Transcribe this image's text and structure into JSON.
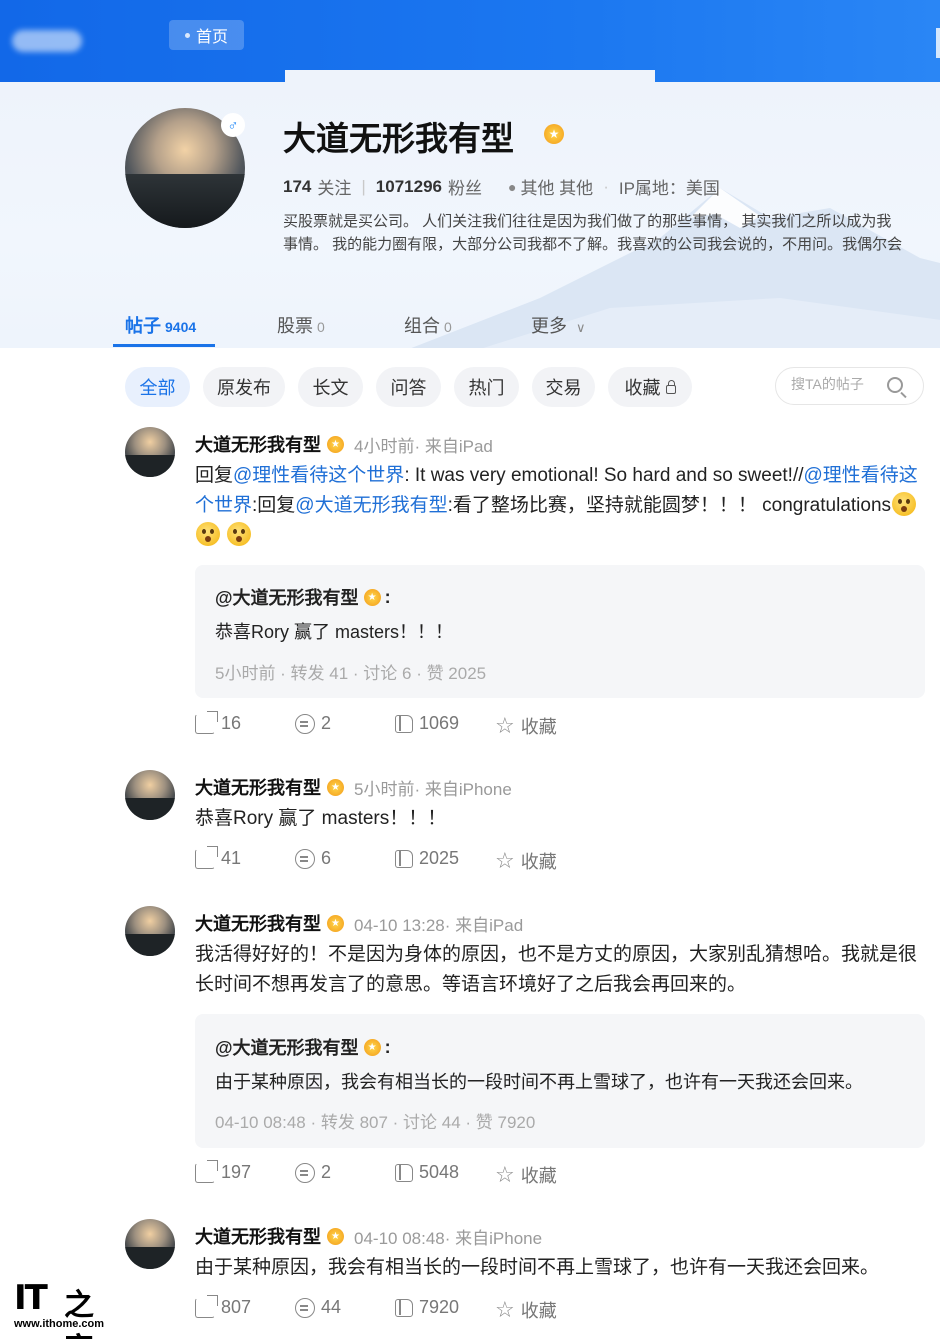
{
  "topbar": {
    "home_label": "首页"
  },
  "profile": {
    "name": "大道无形我有型",
    "gender_symbol": "♂",
    "following_count": "174",
    "following_label": "关注",
    "followers_count": "1071296",
    "followers_label": "粉丝",
    "location": "其他 其他",
    "ip_location": "IP属地：美国",
    "bio_line1": "买股票就是买公司。 人们关注我们往往是因为我们做了的那些事情， 其实我们之所以成为我",
    "bio_line2": "事情。 我的能力圈有限，大部分公司我都不了解。我喜欢的公司我会说的，不用问。我偶尔会"
  },
  "tabs": [
    {
      "label": "帖子",
      "count": "9404"
    },
    {
      "label": "股票",
      "count": "0"
    },
    {
      "label": "组合",
      "count": "0"
    },
    {
      "label": "更多",
      "count": ""
    }
  ],
  "filters": [
    "全部",
    "原发布",
    "长文",
    "问答",
    "热门",
    "交易",
    "收藏"
  ],
  "search": {
    "placeholder": "搜TA的帖子"
  },
  "posts": [
    {
      "author": "大道无形我有型",
      "meta": "4小时前· 来自iPad",
      "text": {
        "p1": "回复",
        "l1": "@理性看待这个世界",
        "p2": ": It was very emotional! So hard and so sweet!//",
        "l2": "@理性看待这个世界",
        "p3": ":回复",
        "l3": "@大道无形我有型",
        "p4": ":看了整场比赛，坚持就能圆梦！！！ congratulations"
      },
      "quote": {
        "author": "@大道无形我有型",
        "text": "恭喜Rory 赢了 masters！！！",
        "meta": "5小时前 · 转发 41 · 讨论 6 · 赞 2025"
      },
      "share": "16",
      "comments": "2",
      "likes": "1069",
      "fav_label": "收藏"
    },
    {
      "author": "大道无形我有型",
      "meta": "5小时前· 来自iPhone",
      "text": "恭喜Rory 赢了 masters！！！",
      "share": "41",
      "comments": "6",
      "likes": "2025",
      "fav_label": "收藏"
    },
    {
      "author": "大道无形我有型",
      "meta": "04-10 13:28· 来自iPad",
      "text_line1": "我活得好好的！不是因为身体的原因，也不是方丈的原因，大家别乱猜想哈。我就是很",
      "text_line2": "长时间不想再发言了的意思。等语言环境好了之后我会再回来的。",
      "quote": {
        "author": "@大道无形我有型",
        "text": "由于某种原因，我会有相当长的一段时间不再上雪球了，也许有一天我还会回来。",
        "meta": "04-10 08:48 · 转发 807 · 讨论 44 · 赞 7920"
      },
      "share": "197",
      "comments": "2",
      "likes": "5048",
      "fav_label": "收藏"
    },
    {
      "author": "大道无形我有型",
      "meta": "04-10 08:48· 来自iPhone",
      "text": "由于某种原因，我会有相当长的一段时间不再上雪球了，也许有一天我还会回来。",
      "share": "807",
      "comments": "44",
      "likes": "7920",
      "fav_label": "收藏"
    }
  ],
  "watermark": {
    "brand": "IT",
    "brand_zh": "之家",
    "url": "www.ithome.com"
  }
}
